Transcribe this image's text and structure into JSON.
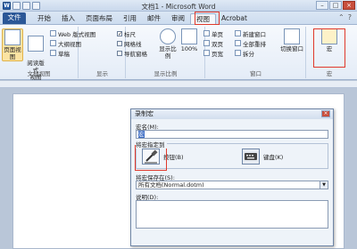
{
  "window": {
    "title": "文档1 - Microsoft Word"
  },
  "tabs": {
    "file": "文件",
    "items": [
      "开始",
      "插入",
      "页面布局",
      "引用",
      "邮件",
      "审阅",
      "视图",
      "Acrobat"
    ],
    "active_index": 6
  },
  "ribbon": {
    "doc_views": {
      "label": "文档视图",
      "print_layout": "页面视图",
      "full_screen": "阅读版式\n视图",
      "web_layout": "Web 版式视图",
      "outline": "大纲视图",
      "draft": "草稿"
    },
    "show": {
      "label": "显示",
      "ruler": "标尺",
      "gridlines": "网格线",
      "nav_pane": "导航窗格"
    },
    "zoom": {
      "label": "显示比例",
      "zoom": "显示比例",
      "hundred": "100%",
      "one_page": "单页",
      "two_pages": "双页",
      "page_width": "页宽"
    },
    "window": {
      "label": "窗口",
      "new_window": "新建窗口",
      "arrange_all": "全部重排",
      "split": "拆分",
      "switch": "切换窗口"
    },
    "macro": {
      "label": "宏",
      "macros": "宏"
    }
  },
  "dialog": {
    "title": "录制宏",
    "close": "×",
    "macro_name_label": "宏名(M):",
    "macro_name_value": "宏",
    "assign_label": "将宏指定到",
    "button_option": "按钮(B)",
    "keyboard_option": "键盘(K)",
    "store_label": "将宏保存在(S):",
    "store_value": "所有文档(Normal.dotm)",
    "description_label": "说明(D):"
  },
  "colors": {
    "file_tab": "#2b5797",
    "highlight": "#e0392b"
  }
}
